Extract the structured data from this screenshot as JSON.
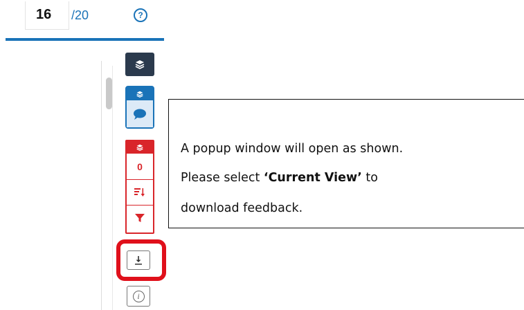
{
  "pager": {
    "current": "16",
    "total": "/20",
    "help_symbol": "?"
  },
  "toolbar": {
    "count": "0",
    "info_symbol": "i",
    "icons": [
      "layers-icon",
      "layers-icon",
      "comment-icon",
      "layers-icon",
      "sort-icon",
      "filter-icon",
      "download-icon",
      "info-icon"
    ]
  },
  "instructions": {
    "line1": "A popup window will open as shown.",
    "line2_prefix": "Please select ",
    "line2_emphasis": "‘Current View’",
    "line2_suffix": " to",
    "line3": "download feedback."
  },
  "colors": {
    "accent_blue": "#1a73b8",
    "dark_button": "#2b3a4d",
    "red": "#d9252a",
    "highlight_red": "#e0101b"
  }
}
